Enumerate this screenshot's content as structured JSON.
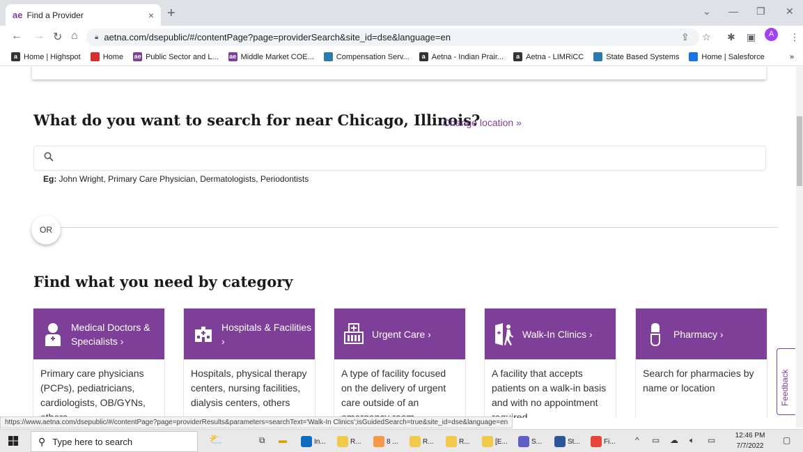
{
  "browser": {
    "tab_title": "Find a Provider",
    "tab_favicon": "ae",
    "tab_close": "×",
    "new_tab": "+",
    "url": "aetna.com/dsepublic/#/contentPage?page=providerSearch&site_id=dse&language=en",
    "avatar_letter": "A",
    "bookmarks": [
      {
        "label": "Home | Highspot",
        "icon": "a",
        "color": "#333333"
      },
      {
        "label": "Home",
        "icon": "",
        "color": "#d32f2f"
      },
      {
        "label": "Public Sector and L...",
        "icon": "ae",
        "color": "#7d3f98"
      },
      {
        "label": "Middle Market COE...",
        "icon": "ae",
        "color": "#7d3f98"
      },
      {
        "label": "Compensation Serv...",
        "icon": "",
        "color": "#2a7ab0"
      },
      {
        "label": "Aetna - Indian Prair...",
        "icon": "a",
        "color": "#333333"
      },
      {
        "label": "Aetna - LIMRiCC",
        "icon": "a",
        "color": "#333333"
      },
      {
        "label": "State Based Systems",
        "icon": "",
        "color": "#2a7ab0"
      },
      {
        "label": "Home | Salesforce",
        "icon": "",
        "color": "#1a73e8"
      }
    ],
    "bookmarks_overflow": "»",
    "status_url": "https://www.aetna.com/dsepublic/#/contentPage?page=providerResults&parameters=searchText='Walk-In Clinics';isGuidedSearch=true&site_id=dse&language=en"
  },
  "page": {
    "heading": "What do you want to search for near Chicago, Illinois?",
    "change_location": "Change location  »",
    "search_placeholder": "",
    "example_prefix": "Eg:",
    "example_text": " John Wright, Primary Care Physician, Dermatologists, Periodontists",
    "or_label": "OR",
    "category_heading": "Find what you need by category",
    "feedback_label": "Feedback",
    "accent_color": "#7d3f98",
    "categories": [
      {
        "title": "Medical Doctors & Specialists  ›",
        "icon": "doctor-icon",
        "description": "Primary care physicians (PCPs), pediatricians, cardiologists, OB/GYNs, others"
      },
      {
        "title": "Hospitals & Facilities  ›",
        "icon": "hospital-icon",
        "description": "Hospitals, physical therapy centers, nursing facilities, dialysis centers, others"
      },
      {
        "title": "Urgent Care  ›",
        "icon": "urgent-care-icon",
        "description": "A type of facility focused on the delivery of urgent care outside of an emergency room"
      },
      {
        "title": "Walk-In Clinics  ›",
        "icon": "walk-in-icon",
        "description": "A facility that accepts patients on a walk-in basis and with no appointment required"
      },
      {
        "title": "Pharmacy  ›",
        "icon": "pharmacy-icon",
        "description": "Search for pharmacies by name or location"
      }
    ]
  },
  "taskbar": {
    "search_placeholder": "Type here to search",
    "apps": [
      {
        "label": "In...",
        "color": "#0f6cbd"
      },
      {
        "label": "R...",
        "color": "#f2c94c"
      },
      {
        "label": "8 ...",
        "color": "#f2994a"
      },
      {
        "label": "R...",
        "color": "#f2c94c"
      },
      {
        "label": "R...",
        "color": "#f2c94c"
      },
      {
        "label": "[E...",
        "color": "#f2c94c"
      },
      {
        "label": "S...",
        "color": "#5b5fc7"
      },
      {
        "label": "St...",
        "color": "#2b579a"
      },
      {
        "label": "Fi...",
        "color": "#e8453c"
      }
    ],
    "time": "12:46 PM",
    "date": "7/7/2022"
  }
}
